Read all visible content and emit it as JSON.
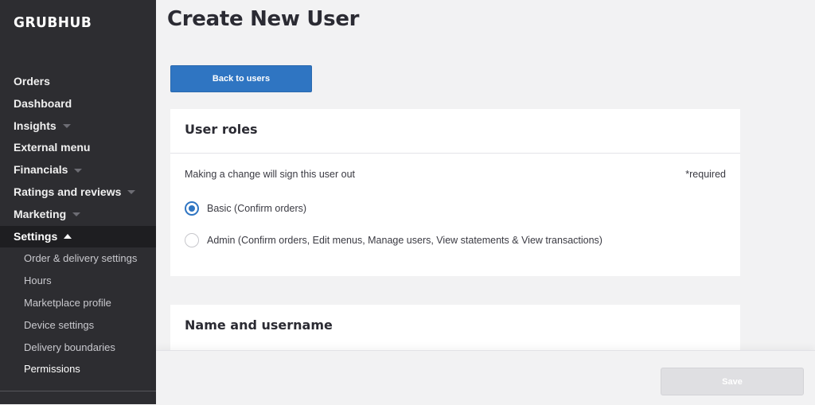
{
  "app": {
    "logo": "GRUBHUB"
  },
  "sidebar": {
    "items": [
      {
        "label": "Orders"
      },
      {
        "label": "Dashboard"
      },
      {
        "label": "Insights"
      },
      {
        "label": "External menu"
      },
      {
        "label": "Financials"
      },
      {
        "label": "Ratings and reviews"
      },
      {
        "label": "Marketing"
      },
      {
        "label": "Settings"
      }
    ],
    "settings_sub": [
      {
        "label": "Order & delivery settings"
      },
      {
        "label": "Hours"
      },
      {
        "label": "Marketplace profile"
      },
      {
        "label": "Device settings"
      },
      {
        "label": "Delivery boundaries"
      },
      {
        "label": "Permissions"
      }
    ]
  },
  "main": {
    "title": "Create New User",
    "back_label": "Back to users",
    "roles_card": {
      "title": "User roles",
      "hint": "Making a change will sign this user out",
      "required": "*required",
      "options": [
        {
          "label": "Basic (Confirm orders)",
          "selected": true
        },
        {
          "label": "Admin (Confirm orders, Edit menus, Manage users, View statements & View transactions)",
          "selected": false
        }
      ]
    },
    "name_card": {
      "title": "Name and username"
    }
  },
  "footer": {
    "save_label": "Save"
  },
  "colors": {
    "accent": "#2f75c2",
    "sidebar": "#2d2d31",
    "sidebar_active": "#1e1e21"
  }
}
